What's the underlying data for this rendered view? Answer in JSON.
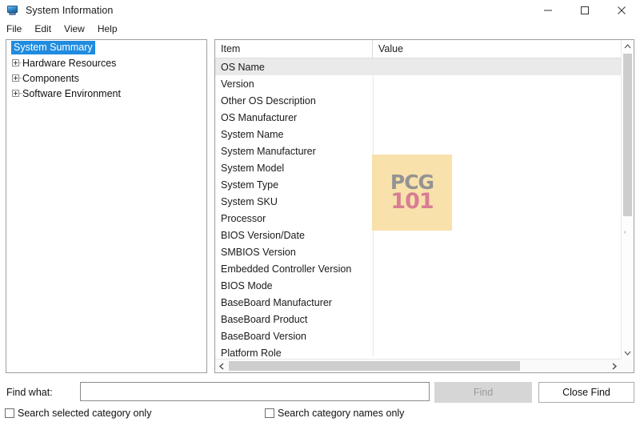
{
  "window": {
    "title": "System Information",
    "icon": "computer-icon",
    "minimize_label": "–",
    "maximize_label": "□",
    "close_label": "✕"
  },
  "menubar": {
    "items": [
      {
        "label": "File"
      },
      {
        "label": "Edit"
      },
      {
        "label": "View"
      },
      {
        "label": "Help"
      }
    ]
  },
  "tree": {
    "nodes": [
      {
        "label": "System Summary",
        "selected": true,
        "expandable": false
      },
      {
        "label": "Hardware Resources",
        "selected": false,
        "expandable": true
      },
      {
        "label": "Components",
        "selected": false,
        "expandable": true
      },
      {
        "label": "Software Environment",
        "selected": false,
        "expandable": true
      }
    ]
  },
  "list": {
    "columns": [
      {
        "label": "Item"
      },
      {
        "label": "Value"
      }
    ],
    "rows": [
      {
        "item": "OS Name",
        "value": "",
        "selected": true
      },
      {
        "item": "Version",
        "value": "",
        "selected": false
      },
      {
        "item": "Other OS Description",
        "value": "",
        "selected": false
      },
      {
        "item": "OS Manufacturer",
        "value": "",
        "selected": false
      },
      {
        "item": "System Name",
        "value": "",
        "selected": false
      },
      {
        "item": "System Manufacturer",
        "value": "",
        "selected": false
      },
      {
        "item": "System Model",
        "value": "",
        "selected": false
      },
      {
        "item": "System Type",
        "value": "",
        "selected": false
      },
      {
        "item": "System SKU",
        "value": "",
        "selected": false
      },
      {
        "item": "Processor",
        "value": "",
        "selected": false
      },
      {
        "item": "BIOS Version/Date",
        "value": "",
        "selected": false
      },
      {
        "item": "SMBIOS Version",
        "value": "",
        "selected": false
      },
      {
        "item": "Embedded Controller Version",
        "value": "",
        "selected": false
      },
      {
        "item": "BIOS Mode",
        "value": "",
        "selected": false
      },
      {
        "item": "BaseBoard Manufacturer",
        "value": "",
        "selected": false
      },
      {
        "item": "BaseBoard Product",
        "value": "",
        "selected": false
      },
      {
        "item": "BaseBoard Version",
        "value": "",
        "selected": false
      },
      {
        "item": "Platform Role",
        "value": "",
        "selected": false
      }
    ]
  },
  "watermark": {
    "top_text": "PCG",
    "bottom_text": "101",
    "background_color": "#f8dfa4",
    "top_color": "#8a8a8a",
    "bottom_color": "#d4748a"
  },
  "findbar": {
    "label": "Find what:",
    "input_value": "",
    "input_placeholder": "",
    "find_button": "Find",
    "find_button_enabled": false,
    "close_find_button": "Close Find",
    "checkbox_selected_category": "Search selected category only",
    "checkbox_category_names": "Search category names only",
    "checkbox_selected_category_checked": false,
    "checkbox_category_names_checked": false
  },
  "theme": {
    "selection_blue": "#1f8ce0",
    "row_selected_gray": "#eaeaea",
    "border_gray": "#9e9e9e"
  }
}
